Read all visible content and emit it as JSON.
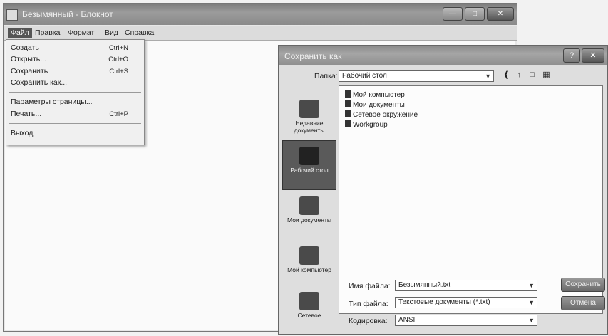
{
  "notepad": {
    "title": "Безымянный - Блокнот",
    "menu": [
      "Файл",
      "Правка",
      "Формат",
      "Вид",
      "Справка"
    ]
  },
  "file_menu": {
    "items": [
      {
        "label": "Создать",
        "shortcut": "Ctrl+N"
      },
      {
        "label": "Открыть...",
        "shortcut": "Ctrl+O"
      },
      {
        "label": "Сохранить",
        "shortcut": "Ctrl+S"
      },
      {
        "label": "Сохранить как...",
        "shortcut": ""
      },
      {
        "label": "Параметры страницы...",
        "shortcut": ""
      },
      {
        "label": "Печать...",
        "shortcut": "Ctrl+P"
      },
      {
        "label": "Выход",
        "shortcut": ""
      }
    ]
  },
  "dialog": {
    "title": "Сохранить как",
    "folder_label": "Папка:",
    "folder_value": "Рабочий стол",
    "places": [
      {
        "label": "Недавние документы",
        "icon": "recent-docs-icon"
      },
      {
        "label": "Рабочий стол",
        "icon": "desktop-icon"
      },
      {
        "label": "Мои документы",
        "icon": "my-documents-icon"
      },
      {
        "label": "Мой компьютер",
        "icon": "my-computer-icon"
      },
      {
        "label": "Сетевое",
        "icon": "network-icon"
      }
    ],
    "files": [
      "Мой компьютер",
      "Мои документы",
      "Сетевое окружение",
      "Workgroup"
    ],
    "filename_label": "Имя файла:",
    "filename_value": "Безымянный.txt",
    "filetype_label": "Тип файла:",
    "filetype_value": "Текстовые документы (*.txt)",
    "encoding_label": "Кодировка:",
    "encoding_value": "ANSI",
    "save_button": "Сохранить",
    "cancel_button": "Отмена"
  }
}
